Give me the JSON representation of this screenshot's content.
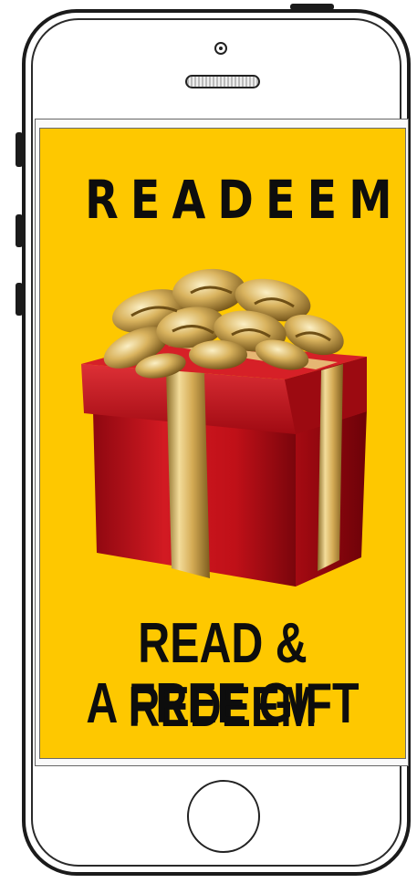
{
  "screen": {
    "title": "READEEM",
    "caption_line1": "READ & REDEEM",
    "caption_line2": "A FREE GIFT",
    "background": "#fec800",
    "text_color": "#0d0d0d"
  },
  "illustration": {
    "icon": "gift-box-icon",
    "box_color": "#c4151c",
    "ribbon_color": "#d8b158"
  },
  "device": {
    "type": "smartphone",
    "frame_color": "#1b1b1b"
  }
}
